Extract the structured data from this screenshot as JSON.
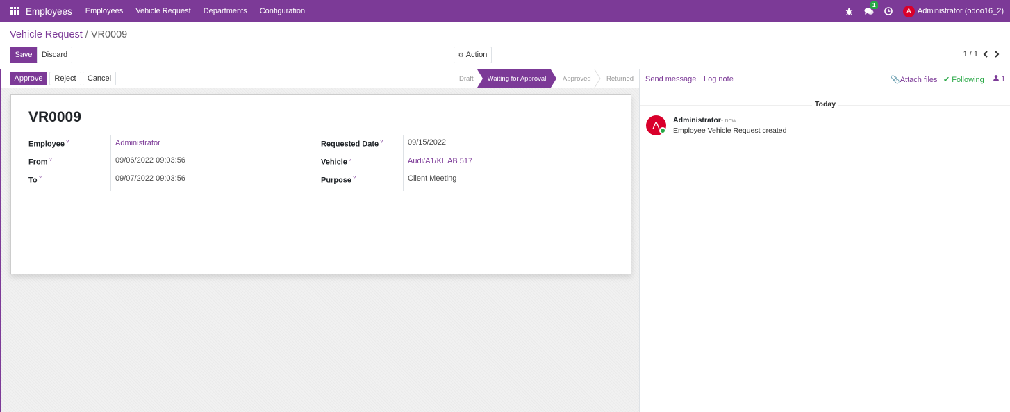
{
  "navbar": {
    "brand": "Employees",
    "menu": [
      "Employees",
      "Vehicle Request",
      "Departments",
      "Configuration"
    ],
    "chat_badge": "1",
    "user_initial": "A",
    "user_name": "Administrator (odoo16_2)"
  },
  "breadcrumb": {
    "parent": "Vehicle Request",
    "separator": "/",
    "current": "VR0009"
  },
  "control": {
    "save": "Save",
    "discard": "Discard",
    "action": "Action",
    "pager": "1 / 1"
  },
  "statusbar": {
    "buttons": [
      "Approve",
      "Reject",
      "Cancel"
    ],
    "stages": [
      "Draft",
      "Waiting for Approval",
      "Approved",
      "Returned"
    ],
    "active_stage": "Waiting for Approval"
  },
  "form": {
    "name": "VR0009",
    "fields_left": [
      {
        "label": "Employee",
        "value": "Administrator",
        "link": true
      },
      {
        "label": "From",
        "value": "09/06/2022 09:03:56",
        "link": false
      },
      {
        "label": "To",
        "value": "09/07/2022 09:03:56",
        "link": false
      }
    ],
    "fields_right": [
      {
        "label": "Requested Date",
        "value": "09/15/2022",
        "link": false
      },
      {
        "label": "Vehicle",
        "value": "Audi/A1/KL AB 517",
        "link": true
      },
      {
        "label": "Purpose",
        "value": "Client Meeting",
        "link": false
      }
    ],
    "help_mark": "?"
  },
  "chatter": {
    "send_message": "Send message",
    "log_note": "Log note",
    "attach_files": "Attach files",
    "following": "Following",
    "followers_count": "1",
    "date_separator": "Today",
    "message": {
      "avatar_initial": "A",
      "author": "Administrator",
      "time": "- now",
      "body": "Employee Vehicle Request created"
    }
  },
  "colors": {
    "brand": "#7c3a97",
    "following": "#28a745",
    "avatar": "#d9002b"
  }
}
